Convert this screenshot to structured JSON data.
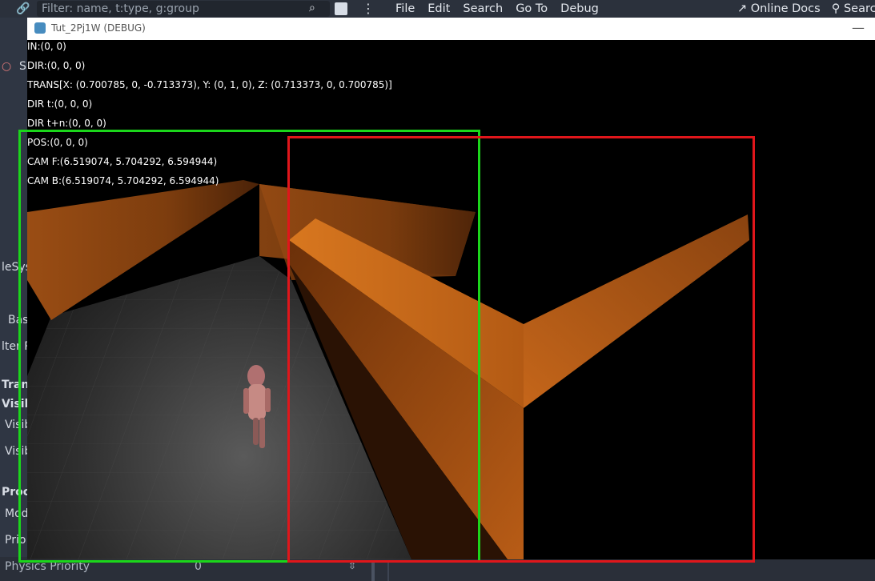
{
  "editor": {
    "filter_placeholder": "Filter: name, t:type, g:group",
    "menu": [
      "File",
      "Edit",
      "Search",
      "Go To",
      "Debug"
    ],
    "online_docs": "Online Docs",
    "search_partial": "Searc",
    "left_dock_fragments": [
      "S",
      "leSys",
      "Bas",
      "lter P",
      "Trans",
      "Visib",
      "Visib",
      "Visib",
      "Proce",
      "Mod",
      "Prio"
    ],
    "physics_priority_label": "Physics Priority",
    "physics_priority_value": "0"
  },
  "window": {
    "title": "Tut_2Pj1W (DEBUG)",
    "minimize": "—"
  },
  "debug_lines": [
    "IN:(0, 0)",
    "DIR:(0, 0, 0)",
    "TRANS[X: (0.700785, 0, -0.713373), Y: (0, 1, 0), Z: (0.713373, 0, 0.700785)]",
    "DIR t:(0, 0, 0)",
    "DIR t+n:(0, 0, 0)",
    "POS:(0, 0, 0)",
    "CAM F:(6.519074, 5.704292, 6.594944)",
    "CAM B:(6.519074, 5.704292, 6.594944)"
  ],
  "colors": {
    "wall_orange": "#c8651a",
    "floor_gray": "#3a3a3a",
    "annotation_green": "#1bd61b",
    "annotation_red": "#e0161b",
    "editor_bg": "#363d4a"
  }
}
